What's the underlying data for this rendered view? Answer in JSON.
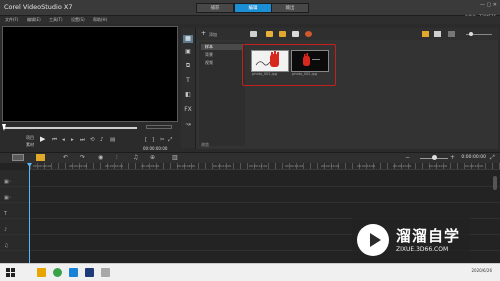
{
  "titlebar": {
    "app_title": "Corel VideoStudio X7",
    "tabs": [
      "捕获",
      "编辑",
      "输出"
    ],
    "active_tab": "编辑",
    "project_size": "未命名, 720*576"
  },
  "menu": [
    "文件(F)",
    "编辑(E)",
    "工具(T)",
    "设置(S)",
    "帮助(H)"
  ],
  "preview": {
    "mode_project": "项目",
    "mode_clip": "素材",
    "timecode": "00:00:00:00"
  },
  "library": {
    "add_label": "添加",
    "folders": [
      "样本",
      "背景",
      "视频"
    ],
    "browse_label": "浏览",
    "media": [
      {
        "caption": "photo_001.jpg",
        "kind": "image"
      },
      {
        "caption": "photo_002.jpg",
        "kind": "image"
      }
    ],
    "colors": {
      "highlight": "#c2211b"
    }
  },
  "timeline": {
    "timecode": "0:00:00:00",
    "ruler_labels": [
      "00:00:00:00",
      "00:00:02:00",
      "00:00:04:00",
      "00:00:06:00",
      "00:00:08:00",
      "00:00:10:00",
      "00:00:12:00",
      "00:00:14:00",
      "00:00:16:00",
      "00:00:18:00",
      "00:00:20:00",
      "00:00:22:00",
      "00:00:24:00"
    ]
  },
  "taskbar": {
    "time": "",
    "date": "2020/6/26"
  },
  "watermark": {
    "title": "溜溜自学",
    "url": "ZIXUE.3D66.COM"
  },
  "colors": {
    "accent": "#1a8fd6",
    "playhead": "#58b8ff"
  }
}
